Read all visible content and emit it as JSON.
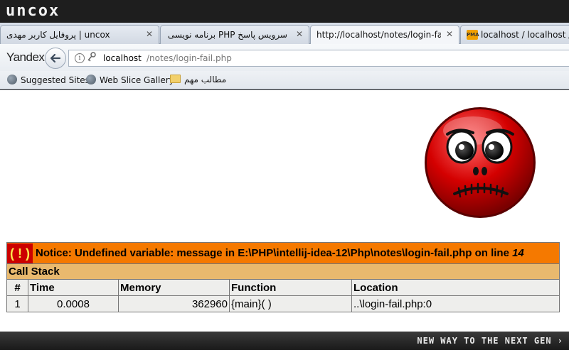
{
  "brand": {
    "logo": "uncox"
  },
  "tabs": [
    {
      "label": "پروفایل کاربر مهدی | uncox",
      "close": "✕",
      "active": false
    },
    {
      "label": "سرویس پاسخ PHP برنامه نویسی وب و",
      "close": "✕",
      "active": false
    },
    {
      "label": "http://localhost/notes/login-fail.php",
      "close": "✕",
      "active": true
    },
    {
      "label": "localhost / localhost / n",
      "icon": "phpmyadmin-icon",
      "active": false
    }
  ],
  "nav": {
    "browser_brand": "Yandex",
    "url_host": "localhost",
    "url_path": "/notes/login-fail.php"
  },
  "bookmarks": [
    {
      "label": "Suggested Sites",
      "icon": "globe-icon"
    },
    {
      "label": "Web Slice Gallery",
      "icon": "globe-icon"
    },
    {
      "label": "مطالب مهم",
      "icon": "folder-icon"
    }
  ],
  "error": {
    "bang": "( ! )",
    "notice": "Notice: Undefined variable: message in E:\\PHP\\intellij-idea-12\\Php\\notes\\login-fail.php on line ",
    "line": "14",
    "call_stack_title": "Call Stack",
    "columns": [
      "#",
      "Time",
      "Memory",
      "Function",
      "Location"
    ],
    "rows": [
      [
        "1",
        "0.0008",
        "362960",
        "{main}( )",
        "..\\login-fail.php:0"
      ]
    ]
  },
  "footer": {
    "slogan": "NEW WAY TO THE NEXT GEN ›"
  },
  "colors": {
    "notice_bg": "#f57900",
    "call_stack_bg": "#e9b96e",
    "table_bg": "#eeeeec",
    "face_red": "#d40000"
  }
}
